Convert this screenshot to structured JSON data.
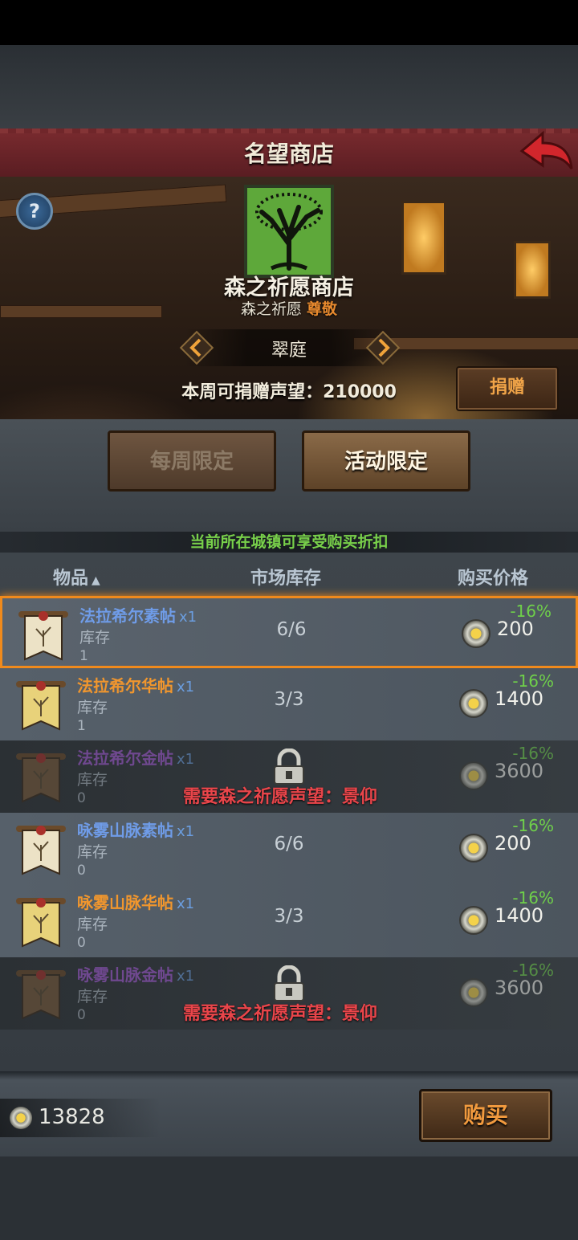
{
  "header": {
    "title": "名望商店"
  },
  "shop": {
    "name": "森之祈愿商店",
    "faction": "森之祈愿",
    "rank": "尊敬",
    "town": "翠庭",
    "donate_label": "本周可捐赠声望：",
    "donate_value": "210000",
    "donate_button": "捐赠"
  },
  "tabs": {
    "weekly": "每周限定",
    "event": "活动限定",
    "active": "event"
  },
  "discount_notice": "当前所在城镇可享受购买折扣",
  "columns": {
    "item": "物品",
    "item_sort": "▲",
    "market": "市场库存",
    "price": "购买价格"
  },
  "items": [
    {
      "name": "法拉希尔素帖",
      "qty": "x1",
      "stock_label": "库存",
      "stock": "1",
      "market": "6/6",
      "price": "200",
      "discount": "-16%",
      "name_color": "#6f9ce8",
      "locked": false,
      "selected": true
    },
    {
      "name": "法拉希尔华帖",
      "qty": "x1",
      "stock_label": "库存",
      "stock": "1",
      "market": "3/3",
      "price": "1400",
      "discount": "-16%",
      "name_color": "#f0962e",
      "locked": false,
      "selected": false
    },
    {
      "name": "法拉希尔金帖",
      "qty": "x1",
      "stock_label": "库存",
      "stock": "0",
      "market": "",
      "price": "3600",
      "discount": "-16%",
      "name_color": "#a55ad8",
      "locked": true,
      "requirement": "需要森之祈愿声望：景仰"
    },
    {
      "name": "咏雾山脉素帖",
      "qty": "x1",
      "stock_label": "库存",
      "stock": "0",
      "market": "6/6",
      "price": "200",
      "discount": "-16%",
      "name_color": "#6f9ce8",
      "locked": false,
      "selected": false
    },
    {
      "name": "咏雾山脉华帖",
      "qty": "x1",
      "stock_label": "库存",
      "stock": "0",
      "market": "3/3",
      "price": "1400",
      "discount": "-16%",
      "name_color": "#f0962e",
      "locked": false,
      "selected": false
    },
    {
      "name": "咏雾山脉金帖",
      "qty": "x1",
      "stock_label": "库存",
      "stock": "0",
      "market": "",
      "price": "3600",
      "discount": "-16%",
      "name_color": "#a55ad8",
      "locked": true,
      "requirement": "需要森之祈愿声望：景仰"
    }
  ],
  "wallet": {
    "amount": "13828"
  },
  "buy_button": "购买"
}
